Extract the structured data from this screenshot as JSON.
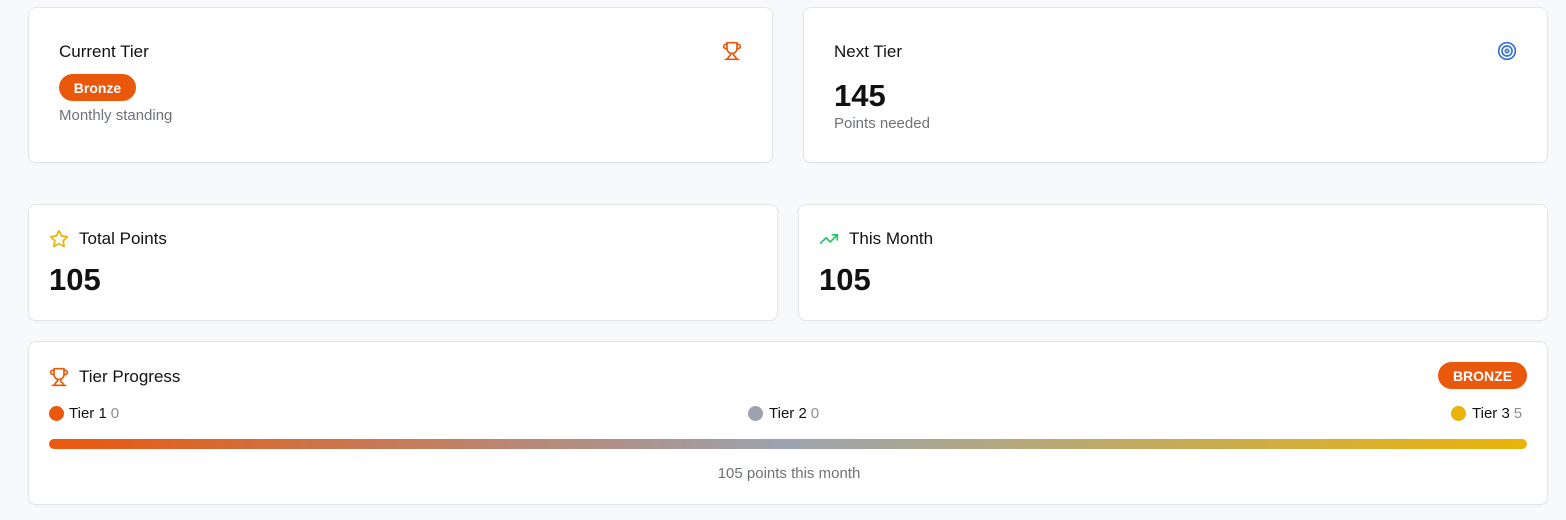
{
  "current_tier": {
    "title": "Current Tier",
    "badge": "Bronze",
    "subtitle": "Monthly standing",
    "icon": "trophy-icon"
  },
  "next_tier": {
    "title": "Next Tier",
    "value": "145",
    "subtitle": "Points needed",
    "icon": "target-icon"
  },
  "total_points": {
    "title": "Total Points",
    "value": "105",
    "icon": "star-icon"
  },
  "this_month": {
    "title": "This Month",
    "value": "105",
    "icon": "trending-up-icon"
  },
  "tier_progress": {
    "title": "Tier Progress",
    "badge": "BRONZE",
    "icon": "trophy-icon",
    "tiers": [
      {
        "label": "Tier 1",
        "count": "0",
        "color": "#ea580c"
      },
      {
        "label": "Tier 2",
        "count": "0",
        "color": "#9ca3af"
      },
      {
        "label": "Tier 3",
        "count": "5",
        "color": "#eab308"
      }
    ],
    "footer": "105 points this month"
  },
  "colors": {
    "accent_orange": "#ea580c",
    "target_blue": "#3b6fd8",
    "star_yellow": "#eab308",
    "trend_green": "#22c55e"
  }
}
